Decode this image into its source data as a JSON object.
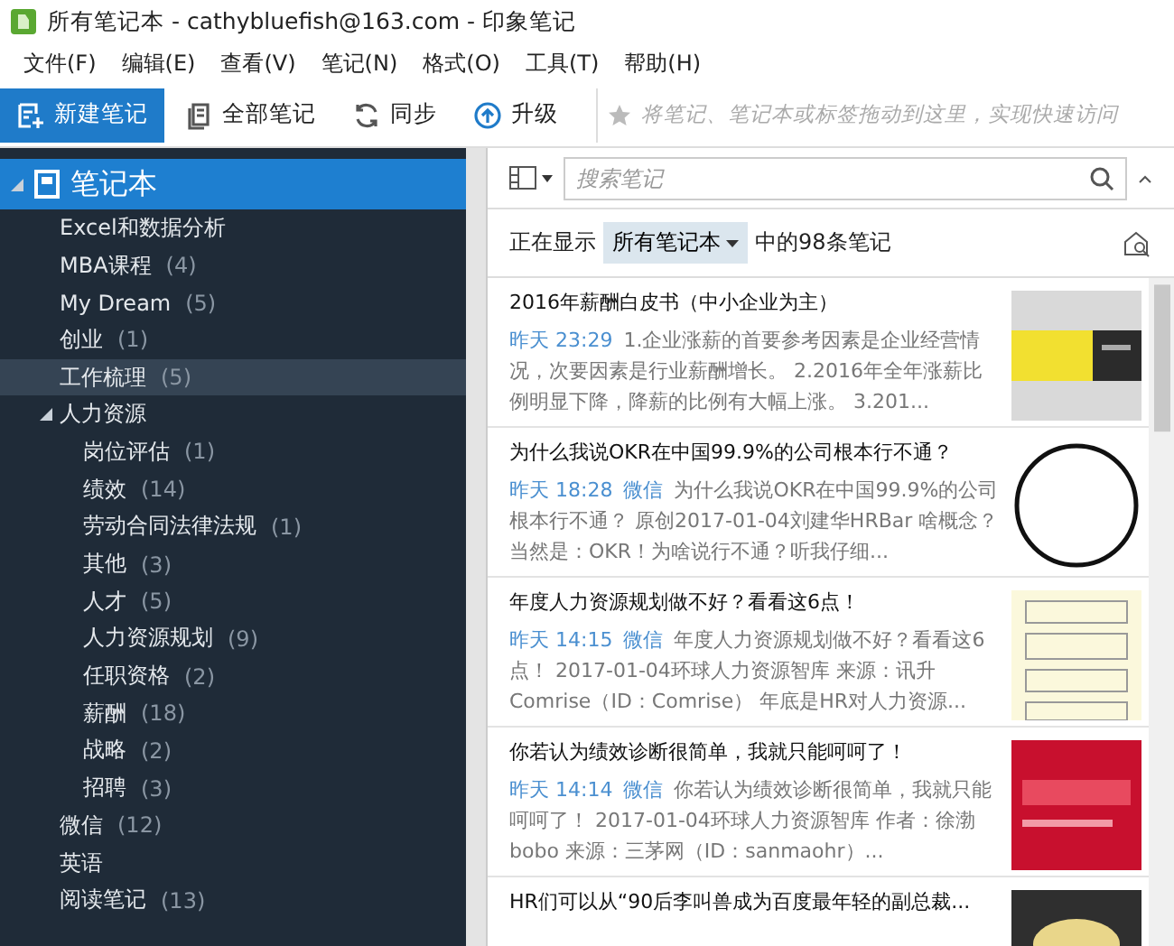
{
  "window": {
    "title": "所有笔记本 - cathybluefish@163.com - 印象笔记"
  },
  "menu": [
    "文件(F)",
    "编辑(E)",
    "查看(V)",
    "笔记(N)",
    "格式(O)",
    "工具(T)",
    "帮助(H)"
  ],
  "toolbar": [
    {
      "kind": "new",
      "label": "新建笔记"
    },
    {
      "kind": "all",
      "label": "全部笔记"
    },
    {
      "kind": "sync",
      "label": "同步"
    },
    {
      "kind": "upgrade",
      "label": "升级"
    }
  ],
  "shortcuts": {
    "placeholder": "将笔记、笔记本或标签拖动到这里，实现快速访问"
  },
  "sidebar": {
    "header": {
      "label": "笔记本",
      "selected": true,
      "expanded": true
    },
    "items": [
      {
        "name": "Excel和数据分析",
        "highlighted": false
      },
      {
        "name": "MBA课程",
        "count": "(4)",
        "highlighted": false
      },
      {
        "name": "My Dream",
        "count": "(5)",
        "highlighted": false
      },
      {
        "name": "创业",
        "count": "(1)",
        "highlighted": false
      },
      {
        "name": "工作梳理",
        "count": "(5)",
        "highlighted": true
      },
      {
        "name": "人力资源",
        "highlighted": false,
        "expanded": true,
        "children": [
          {
            "name": "岗位评估",
            "count": "(1)",
            "highlighted": false
          },
          {
            "name": "绩效",
            "count": "(14)",
            "highlighted": false
          },
          {
            "name": "劳动合同法律法规",
            "count": "(1)",
            "highlighted": false
          },
          {
            "name": "其他",
            "count": "(3)",
            "highlighted": false
          },
          {
            "name": "人才",
            "count": "(5)",
            "highlighted": false
          },
          {
            "name": "人力资源规划",
            "count": "(9)",
            "highlighted": false
          },
          {
            "name": "任职资格",
            "count": "(2)",
            "highlighted": false
          },
          {
            "name": "薪酬",
            "count": "(18)",
            "highlighted": false
          },
          {
            "name": "战略",
            "count": "(2)",
            "highlighted": false
          },
          {
            "name": "招聘",
            "count": "(3)",
            "highlighted": false
          }
        ]
      },
      {
        "name": "微信",
        "count": "(12)",
        "highlighted": false
      },
      {
        "name": "英语",
        "highlighted": false
      },
      {
        "name": "阅读笔记",
        "count": "(13)",
        "highlighted": false
      }
    ]
  },
  "search": {
    "placeholder": "搜索笔记"
  },
  "filter": {
    "prefix": "正在显示",
    "notebook": "所有笔记本",
    "suffix": "中的98条笔记"
  },
  "notes": [
    {
      "title": "2016年薪酬白皮书（中小企业为主）",
      "time": "昨天 23:29",
      "snippet": "1.企业涨薪的首要参考因素是企业经营情况，次要因素是行业薪酬增长。 2.2016年全年涨薪比例明显下降，降薪的比例有大幅上涨。 3.201..."
    },
    {
      "title": "为什么我说OKR在中国99.9%的公司根本行不通？",
      "time": "昨天 18:28",
      "source": "微信",
      "snippet": "为什么我说OKR在中国99.9%的公司根本行不通？ 原创2017-01-04刘建华HRBar 啥概念？当然是：OKR！为啥说行不通？听我仔细..."
    },
    {
      "title": "年度人力资源规划做不好？看看这6点！",
      "time": "昨天 14:15",
      "source": "微信",
      "snippet": "年度人力资源规划做不好？看看这6点！ 2017-01-04环球人力资源智库 来源：讯升Comrise（ID：Comrise） 年底是HR对人力资源..."
    },
    {
      "title": "你若认为绩效诊断很简单，我就只能呵呵了！",
      "time": "昨天 14:14",
      "source": "微信",
      "snippet": "你若认为绩效诊断很简单，我就只能呵呵了！ 2017-01-04环球人力资源智库 作者：徐渤bobo 来源：三茅网（ID：sanmaohr）..."
    },
    {
      "title": "HR们可以从“90后李叫兽成为百度最年轻的副总裁..."
    }
  ]
}
